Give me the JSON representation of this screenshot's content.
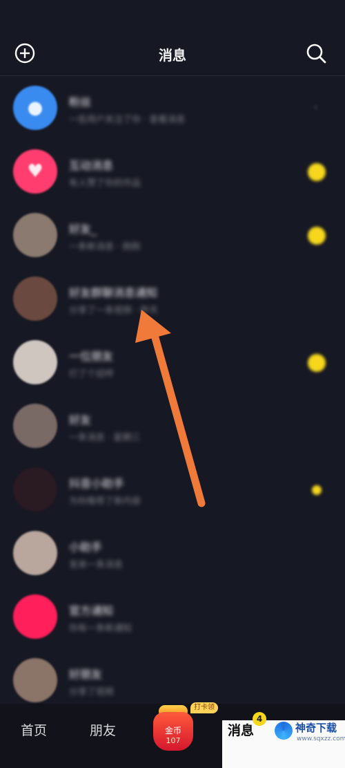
{
  "header": {
    "title": "消息",
    "add_icon": "add-circle-icon",
    "search_icon": "search-icon"
  },
  "conversations": [
    {
      "name": "粉丝",
      "preview": "一些用户关注了你 · 查看消息",
      "avatar_color": "#3a8bf0",
      "avatar_icon": "person-icon",
      "indicator": "chevron"
    },
    {
      "name": "互动消息",
      "preview": "有人赞了你的作品",
      "avatar_color": "#ff3d6e",
      "avatar_icon": "heart-icon",
      "indicator": "badge"
    },
    {
      "name": "好友_",
      "preview": "一条新消息 · 刚刚",
      "avatar_color": "#8a7a70",
      "avatar_icon": "",
      "indicator": "badge"
    },
    {
      "name": "好友群聊消息通知",
      "preview": "分享了一条视频 · 昨天",
      "avatar_color": "#6a4a40",
      "avatar_icon": "",
      "indicator": "none"
    },
    {
      "name": "一位朋友",
      "preview": "打了个招呼",
      "avatar_color": "#cfc6c0",
      "avatar_icon": "",
      "indicator": "badge"
    },
    {
      "name": "好友",
      "preview": "一条消息 · 星期三",
      "avatar_color": "#7a6a66",
      "avatar_icon": "",
      "indicator": "none"
    },
    {
      "name": "抖音小助手",
      "preview": "为你推荐了新内容",
      "avatar_color": "#2a1a22",
      "avatar_icon": "",
      "indicator": "small"
    },
    {
      "name": "小助手",
      "preview": "发来一条消息",
      "avatar_color": "#b9a69c",
      "avatar_icon": "",
      "indicator": "none"
    },
    {
      "name": "官方通知",
      "preview": "你有一条新通知",
      "avatar_color": "#ff1f5a",
      "avatar_icon": "",
      "indicator": "none"
    },
    {
      "name": "好朋友",
      "preview": "分享了视频",
      "avatar_color": "#8b7468",
      "avatar_icon": "",
      "indicator": "none"
    }
  ],
  "bottom_nav": {
    "home": "首页",
    "friends": "朋友",
    "coin_label": "金币",
    "coin_count": "107",
    "coin_tag": "打卡领",
    "messages": "消息",
    "messages_count": "4"
  },
  "annotation": {
    "arrow_color": "#f07a3a"
  },
  "watermark": {
    "name": "神奇下载",
    "url": "www.sqxzz.com"
  }
}
